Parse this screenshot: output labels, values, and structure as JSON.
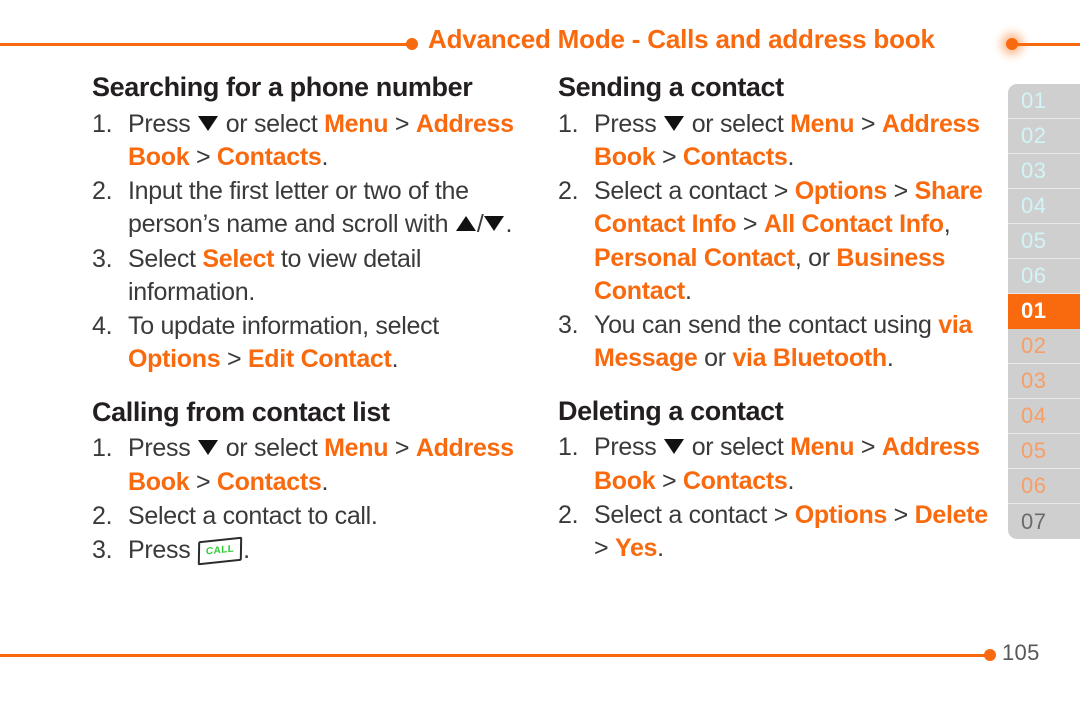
{
  "header": {
    "title": "Advanced Mode - Calls and address book"
  },
  "icons": {
    "down_arrow": "triangle-down-icon",
    "up_arrow": "triangle-up-icon",
    "call_key_label": "CALL",
    "call_key_color": "#2ecc35"
  },
  "colors": {
    "accent": "#f96a0f",
    "body_text": "#3a3a3a",
    "heading": "#231f20",
    "tab_background": "#cfcfcf",
    "tab_active_background": "#f96a0f",
    "tab_label_light": "#d2f4f7",
    "tab_label_orange": "#f79e67",
    "tab_label_dark": "#6b6b6b"
  },
  "left_column": {
    "sections": [
      {
        "title": "Searching for a phone number",
        "steps": [
          {
            "num": "1.",
            "parts": [
              {
                "t": "Press ",
                "s": "plain"
              },
              {
                "t": "▼",
                "s": "glyph-down"
              },
              {
                "t": " or select ",
                "s": "plain"
              },
              {
                "t": "Menu",
                "s": "hl"
              },
              {
                "t": " > ",
                "s": "sep"
              },
              {
                "t": "Address Book",
                "s": "hl"
              },
              {
                "t": " > ",
                "s": "sep"
              },
              {
                "t": "Contacts",
                "s": "hl"
              },
              {
                "t": ".",
                "s": "plain"
              }
            ]
          },
          {
            "num": "2.",
            "parts": [
              {
                "t": "Input the first letter or two of the person’s name and scroll with ",
                "s": "plain"
              },
              {
                "t": "▲",
                "s": "glyph-up"
              },
              {
                "t": "/",
                "s": "plain"
              },
              {
                "t": "▼",
                "s": "glyph-down"
              },
              {
                "t": ".",
                "s": "plain"
              }
            ]
          },
          {
            "num": "3.",
            "parts": [
              {
                "t": "Select ",
                "s": "plain"
              },
              {
                "t": "Select",
                "s": "hl"
              },
              {
                "t": " to view detail information.",
                "s": "plain"
              }
            ]
          },
          {
            "num": "4.",
            "parts": [
              {
                "t": "To update information, select ",
                "s": "plain"
              },
              {
                "t": "Options",
                "s": "hl"
              },
              {
                "t": " > ",
                "s": "sep"
              },
              {
                "t": "Edit Contact",
                "s": "hl"
              },
              {
                "t": ".",
                "s": "plain"
              }
            ]
          }
        ]
      },
      {
        "title": "Calling from contact list",
        "steps": [
          {
            "num": "1.",
            "parts": [
              {
                "t": "Press ",
                "s": "plain"
              },
              {
                "t": "▼",
                "s": "glyph-down"
              },
              {
                "t": " or select ",
                "s": "plain"
              },
              {
                "t": "Menu",
                "s": "hl"
              },
              {
                "t": " > ",
                "s": "sep"
              },
              {
                "t": "Address Book",
                "s": "hl"
              },
              {
                "t": " > ",
                "s": "sep"
              },
              {
                "t": "Contacts",
                "s": "hl"
              },
              {
                "t": ".",
                "s": "plain"
              }
            ]
          },
          {
            "num": "2.",
            "parts": [
              {
                "t": "Select a contact to call.",
                "s": "plain"
              }
            ]
          },
          {
            "num": "3.",
            "parts": [
              {
                "t": "Press ",
                "s": "plain"
              },
              {
                "t": "CALL",
                "s": "glyph-call"
              },
              {
                "t": ".",
                "s": "plain"
              }
            ]
          }
        ]
      }
    ]
  },
  "right_column": {
    "sections": [
      {
        "title": "Sending a contact",
        "steps": [
          {
            "num": "1.",
            "parts": [
              {
                "t": "Press ",
                "s": "plain"
              },
              {
                "t": "▼",
                "s": "glyph-down"
              },
              {
                "t": " or select ",
                "s": "plain"
              },
              {
                "t": "Menu",
                "s": "hl"
              },
              {
                "t": " > ",
                "s": "sep"
              },
              {
                "t": "Address Book",
                "s": "hl"
              },
              {
                "t": " > ",
                "s": "sep"
              },
              {
                "t": "Contacts",
                "s": "hl"
              },
              {
                "t": ".",
                "s": "plain"
              }
            ]
          },
          {
            "num": "2.",
            "parts": [
              {
                "t": "Select a contact > ",
                "s": "plain"
              },
              {
                "t": "Options",
                "s": "hl"
              },
              {
                "t": " > ",
                "s": "sep"
              },
              {
                "t": "Share Contact Info",
                "s": "hl"
              },
              {
                "t": " > ",
                "s": "sep"
              },
              {
                "t": "All Contact Info",
                "s": "hl"
              },
              {
                "t": ", ",
                "s": "plain"
              },
              {
                "t": "Personal Contact",
                "s": "hl"
              },
              {
                "t": ", or ",
                "s": "plain"
              },
              {
                "t": "Business Contact",
                "s": "hl"
              },
              {
                "t": ".",
                "s": "plain"
              }
            ]
          },
          {
            "num": "3.",
            "parts": [
              {
                "t": "You can send the contact using ",
                "s": "plain"
              },
              {
                "t": "via Message",
                "s": "hl"
              },
              {
                "t": " or ",
                "s": "plain"
              },
              {
                "t": "via Bluetooth",
                "s": "hl"
              },
              {
                "t": ".",
                "s": "plain"
              }
            ]
          }
        ]
      },
      {
        "title": "Deleting a contact",
        "steps": [
          {
            "num": "1.",
            "parts": [
              {
                "t": "Press ",
                "s": "plain"
              },
              {
                "t": "▼",
                "s": "glyph-down"
              },
              {
                "t": " or select ",
                "s": "plain"
              },
              {
                "t": "Menu",
                "s": "hl"
              },
              {
                "t": " > ",
                "s": "sep"
              },
              {
                "t": "Address Book",
                "s": "hl"
              },
              {
                "t": " > ",
                "s": "sep"
              },
              {
                "t": "Contacts",
                "s": "hl"
              },
              {
                "t": ".",
                "s": "plain"
              }
            ]
          },
          {
            "num": "2.",
            "parts": [
              {
                "t": "Select a contact > ",
                "s": "plain"
              },
              {
                "t": "Options",
                "s": "hl"
              },
              {
                "t": " > ",
                "s": "sep"
              },
              {
                "t": "Delete",
                "s": "hl"
              },
              {
                "t": " > ",
                "s": "sep"
              },
              {
                "t": "Yes",
                "s": "hl"
              },
              {
                "t": ".",
                "s": "plain"
              }
            ]
          }
        ]
      }
    ]
  },
  "tab_strip": {
    "tabs": [
      {
        "label": "01",
        "style": "light"
      },
      {
        "label": "02",
        "style": "light"
      },
      {
        "label": "03",
        "style": "light"
      },
      {
        "label": "04",
        "style": "light"
      },
      {
        "label": "05",
        "style": "light"
      },
      {
        "label": "06",
        "style": "light"
      },
      {
        "label": "01",
        "style": "active"
      },
      {
        "label": "02",
        "style": "orange"
      },
      {
        "label": "03",
        "style": "orange"
      },
      {
        "label": "04",
        "style": "orange"
      },
      {
        "label": "05",
        "style": "orange"
      },
      {
        "label": "06",
        "style": "orange"
      },
      {
        "label": "07",
        "style": "dark"
      }
    ]
  },
  "footer": {
    "page_number": "105"
  }
}
